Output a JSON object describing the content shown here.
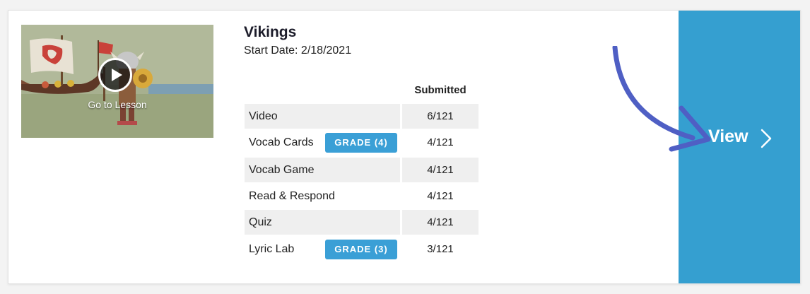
{
  "lesson": {
    "title": "Vikings",
    "start_date": "Start Date: 2/18/2021",
    "thumbnail_label": "Go to Lesson",
    "thumbnail_icon": "play-icon"
  },
  "table": {
    "header": "Submitted",
    "rows": [
      {
        "label": "Video",
        "value": "6/121",
        "grade": null
      },
      {
        "label": "Vocab Cards",
        "value": "4/121",
        "grade": "GRADE (4)"
      },
      {
        "label": "Vocab Game",
        "value": "4/121",
        "grade": null
      },
      {
        "label": "Read & Respond",
        "value": "4/121",
        "grade": null
      },
      {
        "label": "Quiz",
        "value": "4/121",
        "grade": null
      },
      {
        "label": "Lyric Lab",
        "value": "3/121",
        "grade": "GRADE (3)"
      }
    ]
  },
  "view": {
    "label": "View",
    "icon": "chevron-right-icon"
  },
  "annotation": {
    "icon": "curved-arrow-icon",
    "color": "#4f5fc4"
  },
  "colors": {
    "accent": "#359fd0",
    "grade_button": "#3a9fd6",
    "row_shade": "#efefef"
  }
}
